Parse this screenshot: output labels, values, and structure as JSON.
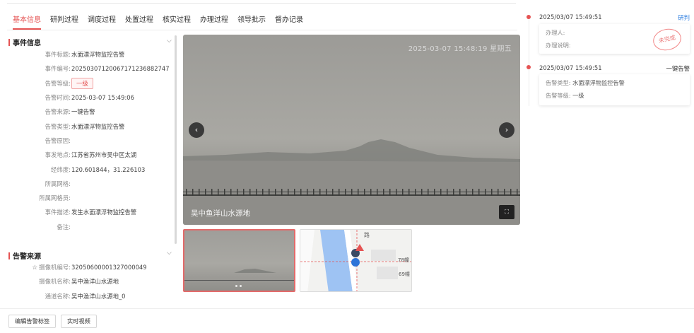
{
  "tabs": [
    "基本信息",
    "研判过程",
    "调度过程",
    "处置过程",
    "核实过程",
    "办理过程",
    "领导批示",
    "督办记录"
  ],
  "event_section": {
    "title": "事件信息",
    "rows": [
      {
        "k": "事件标题:",
        "v": "水面漂浮物监控告警"
      },
      {
        "k": "事件编号:",
        "v": "202503071200671712368827 47"
      },
      {
        "k": "告警等级:",
        "v": "一级",
        "badge": true
      },
      {
        "k": "告警时间:",
        "v": "2025-03-07 15:49:06"
      },
      {
        "k": "告警来源:",
        "v": "一键告警"
      },
      {
        "k": "告警类型:",
        "v": "水面漂浮物监控告警"
      },
      {
        "k": "告警原因:",
        "v": ""
      },
      {
        "k": "事发地点:",
        "v": "江苏省苏州市吴中区太湖"
      },
      {
        "k": "经纬度:",
        "v": "120.601844，31.226103"
      },
      {
        "k": "所属网格:",
        "v": ""
      },
      {
        "k": "所属网格员:",
        "v": ""
      },
      {
        "k": "事件描述:",
        "v": "发生水面漂浮物监控告警"
      },
      {
        "k": "备注:",
        "v": ""
      }
    ]
  },
  "viewer": {
    "timestamp": "2025-03-07 15:48:19 星期五",
    "caption": "吴中鱼洋山水源地",
    "prev": "‹",
    "next": "›",
    "fullscreen": "⛶"
  },
  "map_thumb": {
    "road_label": "路",
    "label_a": "78幢",
    "label_b": "69幢"
  },
  "source_section": {
    "title": "告警来源",
    "rows": [
      {
        "k": "摄像机编号:",
        "v": "32050600001327000049",
        "star": "☆"
      },
      {
        "k": "摄像机名称:",
        "v": "吴中渔洋山水源地"
      },
      {
        "k": "通道名称:",
        "v": "吴中渔洋山水源地_0"
      }
    ]
  },
  "timeline": [
    {
      "time": "2025/03/07 15:49:51",
      "tag": "研判",
      "tag_color": "#2f7fe0",
      "rows": [
        {
          "k": "办理人:",
          "v": ""
        },
        {
          "k": "办理说明:",
          "v": ""
        }
      ],
      "stamp": "未完成"
    },
    {
      "time": "2025/03/07 15:49:51",
      "tag": "一键告警",
      "tag_color": "#333333",
      "rows": [
        {
          "k": "告警类型:",
          "v": "水面漂浮物监控告警"
        },
        {
          "k": "告警等级:",
          "v": "一级"
        }
      ]
    }
  ],
  "footer": {
    "edit_tag": "编辑告警标签",
    "live_video": "实时视频"
  },
  "colors": {
    "accent": "#e55353",
    "link": "#2f7fe0"
  }
}
